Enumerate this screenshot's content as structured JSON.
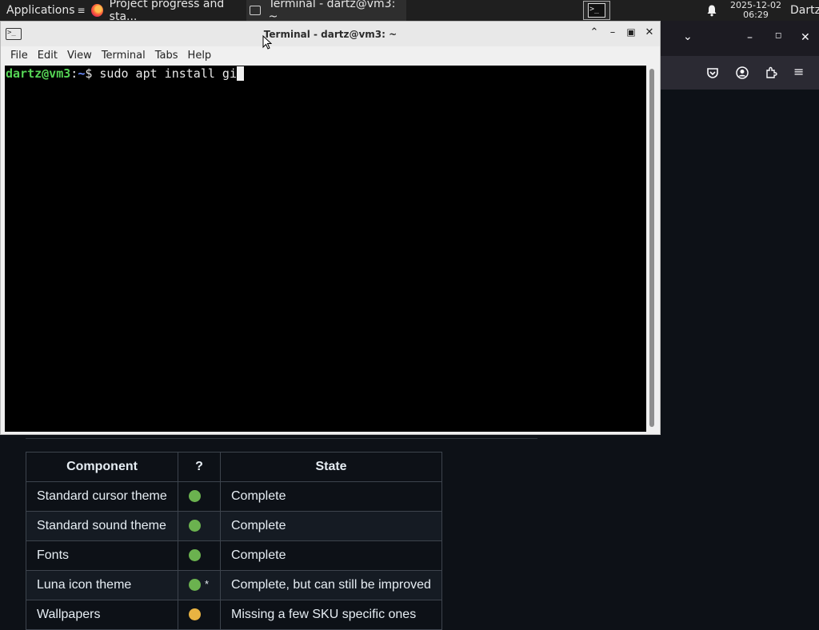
{
  "top_panel": {
    "applications_label": "Applications",
    "tasks": [
      {
        "label": "Project progress and sta...",
        "icon": "firefox-icon"
      },
      {
        "label": "Terminal - dartz@vm3: ~",
        "icon": "terminal-icon"
      }
    ],
    "clock_date": "2025-12-02",
    "clock_time": "06:29",
    "username": "Dartz"
  },
  "terminal": {
    "title": "Terminal - dartz@vm3: ~",
    "menu": [
      "File",
      "Edit",
      "View",
      "Terminal",
      "Tabs",
      "Help"
    ],
    "prompt_user": "dartz@vm3",
    "prompt_sep": ":",
    "prompt_path": "~",
    "prompt_symbol": "$",
    "command": " sudo apt install gi"
  },
  "page_table": {
    "headers": [
      "Component",
      "?",
      "State"
    ],
    "rows": [
      {
        "component": "Standard cursor theme",
        "status_color": "#6bb24f",
        "star": "",
        "state": "Complete"
      },
      {
        "component": "Standard sound theme",
        "status_color": "#6bb24f",
        "star": "",
        "state": "Complete"
      },
      {
        "component": "Fonts",
        "status_color": "#6bb24f",
        "star": "",
        "state": "Complete"
      },
      {
        "component": "Luna icon theme",
        "status_color": "#6bb24f",
        "star": "*",
        "state": "Complete, but can still be improved"
      },
      {
        "component": "Wallpapers",
        "status_color": "#e9b342",
        "star": "",
        "state": "Missing a few SKU specific ones"
      }
    ]
  },
  "colors": {
    "prompt_user": "#55d455",
    "prompt_path": "#6c8dff",
    "page_background": "#0d1117"
  }
}
